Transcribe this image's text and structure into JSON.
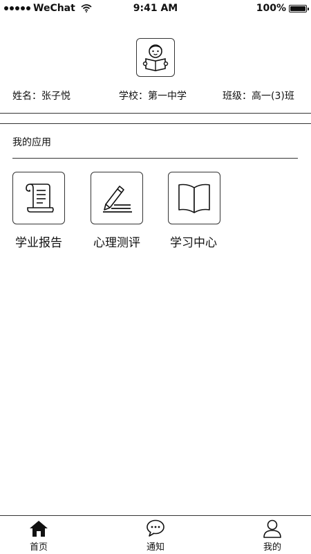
{
  "status_bar": {
    "carrier": "WeChat",
    "time": "9:41 AM",
    "battery": "100%",
    "battery_level": 1.0
  },
  "profile": {
    "avatar_icon": "reading-student-icon",
    "name": "姓名：张子悦",
    "school": "学校：第一中学",
    "class": "班级：高一(3)班"
  },
  "apps_section": {
    "title": "我的应用",
    "items": [
      {
        "label": "学业报告",
        "icon": "scroll-icon"
      },
      {
        "label": "心理测评",
        "icon": "pencil-icon"
      },
      {
        "label": "学习中心",
        "icon": "book-icon"
      }
    ]
  },
  "tab_bar": {
    "items": [
      {
        "label": "首页",
        "icon": "home-icon",
        "active": true
      },
      {
        "label": "通知",
        "icon": "chat-bubble-icon",
        "active": false
      },
      {
        "label": "我的",
        "icon": "user-icon",
        "active": false
      }
    ]
  }
}
